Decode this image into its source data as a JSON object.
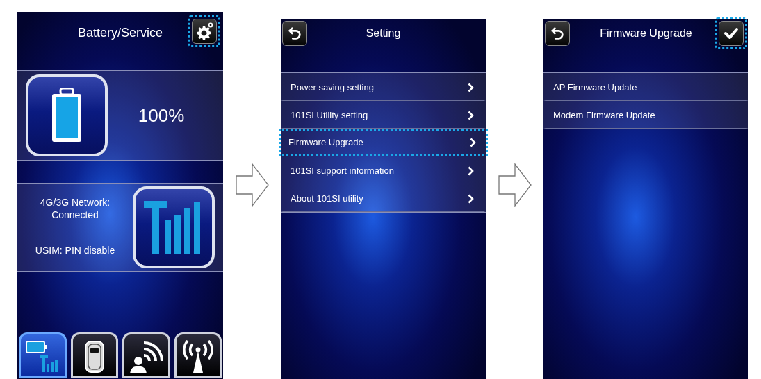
{
  "screens": [
    {
      "kind": "status",
      "title": "Battery/Service",
      "settings_button": {
        "highlighted": true
      },
      "battery_reading": "100%",
      "network_lines": [
        "4G/3G Network:",
        "Connected"
      ],
      "usim": "USIM: PIN disable",
      "tabs": [
        {
          "kind": "battery",
          "selected": true
        },
        {
          "kind": "device",
          "selected": false
        },
        {
          "kind": "person",
          "selected": false
        },
        {
          "kind": "antenna",
          "selected": false
        }
      ]
    },
    {
      "kind": "menu",
      "title": "Setting",
      "items": [
        {
          "label": "Power saving setting",
          "chevron": true,
          "highlighted": false
        },
        {
          "label": "101SI Utility setting",
          "chevron": true,
          "highlighted": false
        },
        {
          "label": "Firmware Upgrade",
          "chevron": true,
          "highlighted": true
        },
        {
          "label": "101SI support information",
          "chevron": true,
          "highlighted": false
        },
        {
          "label": "About 101SI utility",
          "chevron": true,
          "highlighted": false
        }
      ]
    },
    {
      "kind": "menu",
      "title": "Firmware Upgrade",
      "confirm_button": {
        "highlighted": true
      },
      "items": [
        {
          "label": "AP Firmware Update",
          "chevron": false,
          "highlighted": false
        },
        {
          "label": "Modem Firmware Update",
          "chevron": false,
          "highlighted": false
        }
      ]
    }
  ]
}
